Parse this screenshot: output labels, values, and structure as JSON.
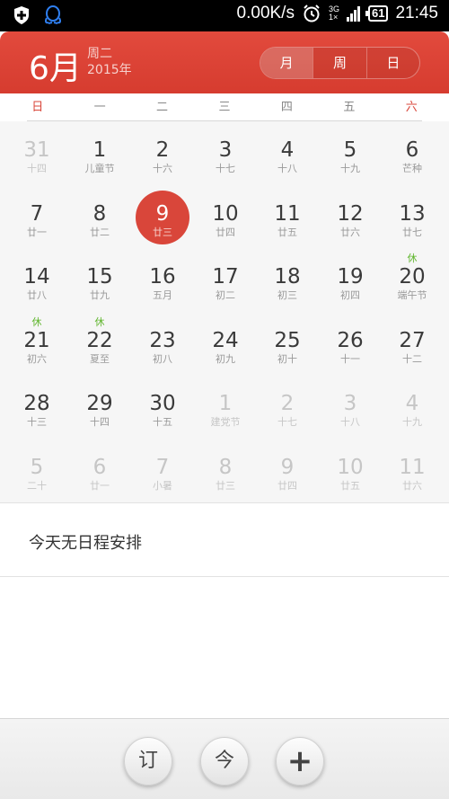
{
  "status_bar": {
    "net_speed": "0.00K/s",
    "signal_type": "3G",
    "signal_sub": "1×",
    "battery": "61",
    "time": "21:45"
  },
  "header": {
    "month": "6月",
    "weekday": "周二",
    "year": "2015年",
    "view_tabs": [
      "月",
      "周",
      "日"
    ]
  },
  "weekdays": [
    "日",
    "一",
    "二",
    "三",
    "四",
    "五",
    "六"
  ],
  "days": [
    {
      "n": "31",
      "sub": "十四",
      "other": true
    },
    {
      "n": "1",
      "sub": "儿童节"
    },
    {
      "n": "2",
      "sub": "十六"
    },
    {
      "n": "3",
      "sub": "十七"
    },
    {
      "n": "4",
      "sub": "十八"
    },
    {
      "n": "5",
      "sub": "十九"
    },
    {
      "n": "6",
      "sub": "芒种"
    },
    {
      "n": "7",
      "sub": "廿一"
    },
    {
      "n": "8",
      "sub": "廿二"
    },
    {
      "n": "9",
      "sub": "廿三",
      "selected": true
    },
    {
      "n": "10",
      "sub": "廿四"
    },
    {
      "n": "11",
      "sub": "廿五"
    },
    {
      "n": "12",
      "sub": "廿六"
    },
    {
      "n": "13",
      "sub": "廿七"
    },
    {
      "n": "14",
      "sub": "廿八"
    },
    {
      "n": "15",
      "sub": "廿九"
    },
    {
      "n": "16",
      "sub": "五月"
    },
    {
      "n": "17",
      "sub": "初二"
    },
    {
      "n": "18",
      "sub": "初三"
    },
    {
      "n": "19",
      "sub": "初四"
    },
    {
      "n": "20",
      "sub": "端午节",
      "badge": "休"
    },
    {
      "n": "21",
      "sub": "初六",
      "badge": "休"
    },
    {
      "n": "22",
      "sub": "夏至",
      "badge": "休"
    },
    {
      "n": "23",
      "sub": "初八"
    },
    {
      "n": "24",
      "sub": "初九"
    },
    {
      "n": "25",
      "sub": "初十"
    },
    {
      "n": "26",
      "sub": "十一"
    },
    {
      "n": "27",
      "sub": "十二"
    },
    {
      "n": "28",
      "sub": "十三"
    },
    {
      "n": "29",
      "sub": "十四"
    },
    {
      "n": "30",
      "sub": "十五"
    },
    {
      "n": "1",
      "sub": "建党节",
      "other": true
    },
    {
      "n": "2",
      "sub": "十七",
      "other": true
    },
    {
      "n": "3",
      "sub": "十八",
      "other": true
    },
    {
      "n": "4",
      "sub": "十九",
      "other": true
    },
    {
      "n": "5",
      "sub": "二十",
      "other": true
    },
    {
      "n": "6",
      "sub": "廿一",
      "other": true
    },
    {
      "n": "7",
      "sub": "小暑",
      "other": true
    },
    {
      "n": "8",
      "sub": "廿三",
      "other": true
    },
    {
      "n": "9",
      "sub": "廿四",
      "other": true
    },
    {
      "n": "10",
      "sub": "廿五",
      "other": true
    },
    {
      "n": "11",
      "sub": "廿六",
      "other": true
    }
  ],
  "events": {
    "empty_text": "今天无日程安排"
  },
  "bottom_bar": {
    "subscribe": "订",
    "today": "今",
    "add": "+"
  },
  "colors": {
    "accent": "#d9463a",
    "holiday": "#5fb52c"
  }
}
